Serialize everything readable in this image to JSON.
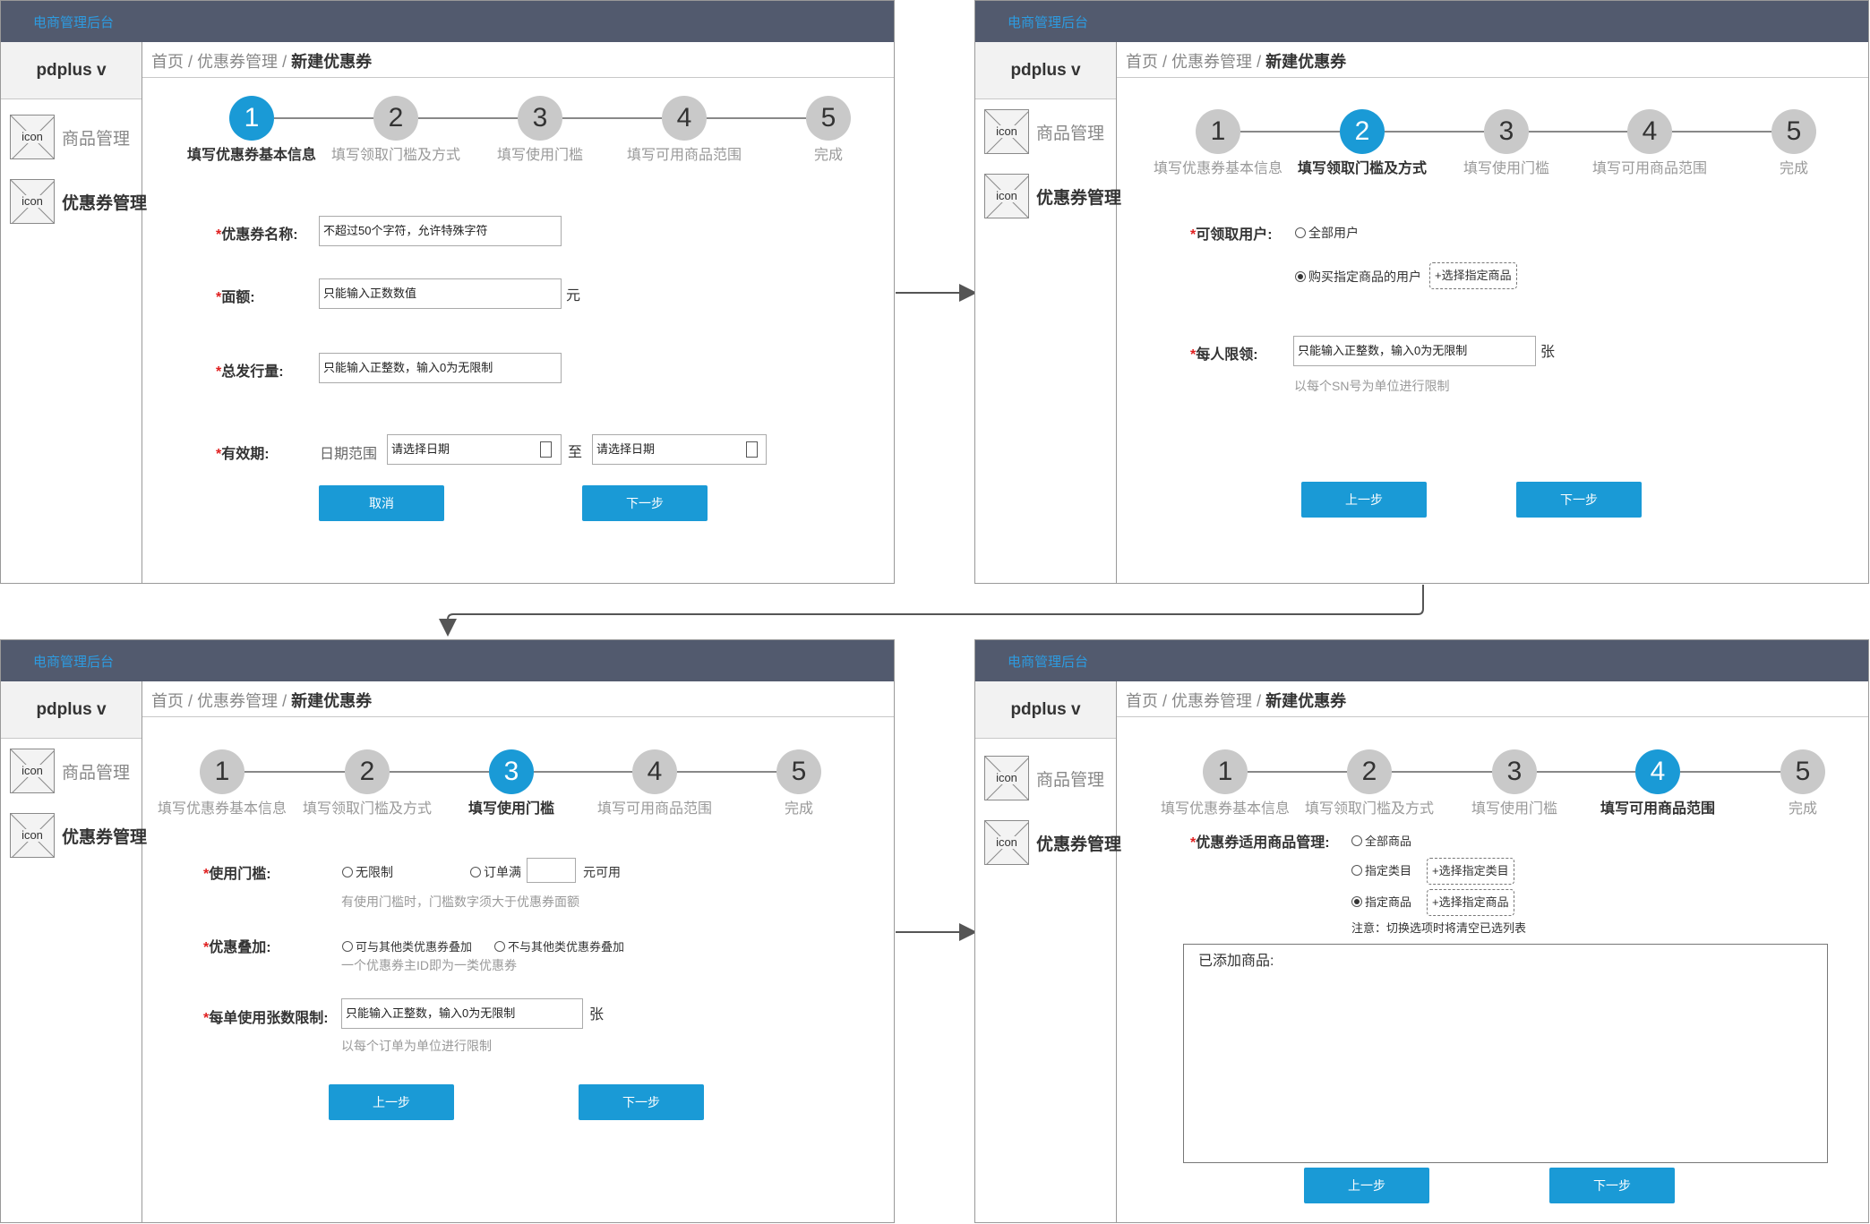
{
  "app_title": "电商管理后台",
  "user_menu": "pdplus v",
  "nav": {
    "icon_text": "icon",
    "goods": "商品管理",
    "coupons": "优惠券管理"
  },
  "breadcrumb": {
    "home": "首页",
    "sep": "/",
    "coupon_mgmt": "优惠券管理",
    "current": "新建优惠券"
  },
  "steps": [
    {
      "num": "1",
      "label": "填写优惠券基本信息"
    },
    {
      "num": "2",
      "label": "填写领取门槛及方式"
    },
    {
      "num": "3",
      "label": "填写使用门槛"
    },
    {
      "num": "4",
      "label": "填写可用商品范围"
    },
    {
      "num": "5",
      "label": "完成"
    }
  ],
  "screen1": {
    "active_step": 1,
    "name_label": "优惠券名称:",
    "name_placeholder": "不超过50个字符，允许特殊字符",
    "amount_label": "面额:",
    "amount_placeholder": "只能输入正数数值",
    "amount_unit": "元",
    "total_label": "总发行量:",
    "total_placeholder": "只能输入正整数，输入0为无限制",
    "validity_label": "有效期:",
    "date_range_label": "日期范围",
    "date_start_placeholder": "请选择日期",
    "date_to": "至",
    "date_end_placeholder": "请选择日期",
    "cancel": "取消",
    "next": "下一步"
  },
  "screen2": {
    "active_step": 2,
    "users_label": "可领取用户:",
    "all_users": "全部用户",
    "buyers": "购买指定商品的用户",
    "select_goods": "+选择指定商品",
    "limit_label": "每人限领:",
    "limit_placeholder": "只能输入正整数，输入0为无限制",
    "limit_unit": "张",
    "limit_hint": "以每个SN号为单位进行限制",
    "prev": "上一步",
    "next": "下一步"
  },
  "screen3": {
    "active_step": 3,
    "threshold_label": "使用门槛:",
    "no_limit": "无限制",
    "order_full": "订单满",
    "yuan_usable": "元可用",
    "threshold_hint": "有使用门槛时，门槛数字须大于优惠券面额",
    "stack_label": "优惠叠加:",
    "stack_yes": "可与其他类优惠券叠加",
    "stack_no": "不与其他类优惠券叠加",
    "stack_hint": "一个优惠券主ID即为一类优惠券",
    "per_order_label": "每单使用张数限制:",
    "per_order_placeholder": "只能输入正整数，输入0为无限制",
    "per_order_unit": "张",
    "per_order_hint": "以每个订单为单位进行限制",
    "prev": "上一步",
    "next": "下一步"
  },
  "screen4": {
    "active_step": 4,
    "scope_label": "优惠券适用商品管理:",
    "all_goods": "全部商品",
    "category": "指定类目",
    "select_category": "+选择指定类目",
    "specific_goods": "指定商品",
    "select_goods": "+选择指定商品",
    "note": "注意：切换选项时将清空已选列表",
    "added_title": "已添加商品:",
    "prev": "上一步",
    "next": "下一步"
  },
  "colors": {
    "topbar": "#525a6e",
    "accent": "#1a9ad6",
    "required_star": "#e02020"
  }
}
